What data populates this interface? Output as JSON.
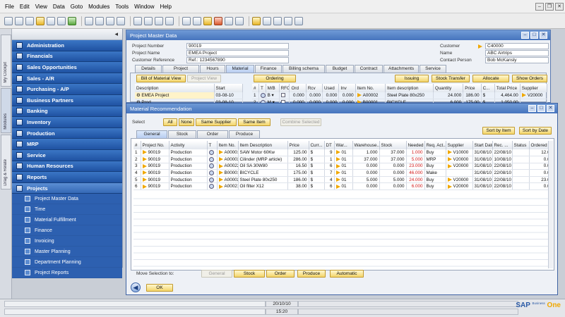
{
  "menu": [
    "File",
    "Edit",
    "View",
    "Data",
    "Goto",
    "Modules",
    "Tools",
    "Window",
    "Help"
  ],
  "vtabs": [
    "My Cockpit",
    "Modules",
    "Drag & Relate"
  ],
  "sidebar": {
    "modules": [
      "Administration",
      "Financials",
      "Sales Opportunities",
      "Sales - A/R",
      "Purchasing - A/P",
      "Business Partners",
      "Banking",
      "Inventory",
      "Production",
      "MRP",
      "Service",
      "Human Resources",
      "Reports",
      "Projects"
    ],
    "sub": [
      "Project Master Data",
      "Time",
      "Material Fulfillment",
      "Finance",
      "Invoicing",
      "Master Planning",
      "Department Planning",
      "Project Reports"
    ]
  },
  "pmd": {
    "title": "Project Master Data",
    "project_number_label": "Project Number",
    "project_number": "90019",
    "project_name_label": "Project Name",
    "project_name": "EMEA Project",
    "cust_ref_label": "Customer Reference",
    "cust_ref": "Ref.: 1234567890",
    "customer_label": "Customer",
    "customer": "C40000",
    "name_label": "Name",
    "name": "ABC Airtrips",
    "contact_label": "Contact Person",
    "contact": "Bob McKansly",
    "tabs": [
      "Details",
      "Project Members",
      "Hours",
      "Material",
      "Finance",
      "Billing schema",
      "Budget",
      "Contract",
      "Attachments",
      "Service"
    ],
    "btn_bom": "Bill of Material View",
    "btn_pv": "Project View",
    "btn_ordering": "Ordering",
    "btn_issuing": "Issuing",
    "btn_stock_transfer": "Stock Transfer",
    "btn_allocate": "Allocate",
    "btn_show_orders": "Show Orders",
    "tree_head": [
      "Description",
      "Start"
    ],
    "tree": [
      {
        "desc": "EMEA Project",
        "start": "03-08-10"
      },
      {
        "desc": "Prod",
        "start": "03-08-10"
      }
    ],
    "grid_head": [
      "#",
      "T",
      "M/B",
      "RFO",
      "Ord",
      "Rcv",
      "Used",
      "Inv",
      "Item No.",
      "Item description",
      "Quantity",
      "Price",
      "C...",
      "Total Price",
      "Supplier"
    ],
    "grid_rows": [
      {
        "n": "1",
        "t": "",
        "mb": "B",
        "ord": "0.000",
        "rcv": "0.000",
        "used": "0.000",
        "inv": "0.000",
        "item": "A00002",
        "desc": "Steel Plate 80x250",
        "qty": "24.000",
        "price": "186.00",
        "cur": "$",
        "total": "4,464.00",
        "sup": "V20000"
      },
      {
        "n": "2",
        "t": "",
        "mb": "M",
        "ord": "0.000",
        "rcv": "0.000",
        "used": "0.000",
        "inv": "0.000",
        "item": "B00001",
        "desc": "BICYCLE",
        "qty": "6.000",
        "price": "175.00",
        "cur": "$",
        "total": "1,050.00",
        "sup": ""
      }
    ]
  },
  "mr": {
    "title": "Material Recommendation",
    "select_label": "Select",
    "select_btns": [
      "All",
      "None",
      "Same Supplier",
      "Same Item",
      "Combine Selected"
    ],
    "tabs": [
      "General",
      "Stock",
      "Order",
      "Produce"
    ],
    "sort_item": "Sort by Item",
    "sort_date": "Sort by Date",
    "head": [
      "#",
      "Project No.",
      "Activity",
      "T",
      "Item No.",
      "Item Description",
      "Price",
      "Curr...",
      "DT",
      "War...",
      "Warehouse...",
      "Stock",
      "Needed",
      "Req. Act...",
      "Supplier",
      "Start Date",
      "Rec. ...",
      "Status",
      "Ordered"
    ],
    "rows": [
      {
        "n": "1",
        "proj": "90019",
        "act": "Production",
        "item": "A00001",
        "desc": "SAW Motor 60Kw",
        "price": "125.00",
        "cur": "$",
        "dt": "9",
        "war": "01",
        "wh": "1.000",
        "stock": "37.000",
        "need": "1.000",
        "req": "Buy",
        "sup": "V10000",
        "start": "31/08/10",
        "rec": "22/08/10",
        "status": "",
        "ord": "12.0"
      },
      {
        "n": "2",
        "proj": "90019",
        "act": "Production",
        "item": "A00003",
        "desc": "Cilinder (MRP article)",
        "price": "286.00",
        "cur": "$",
        "dt": "1",
        "war": "01",
        "wh": "37.000",
        "stock": "37.000",
        "need": "5.000",
        "req": "MRP",
        "sup": "V20000",
        "start": "31/08/10",
        "rec": "10/08/10",
        "status": "",
        "ord": "0.0"
      },
      {
        "n": "3",
        "proj": "90019",
        "act": "Production",
        "item": "A00022",
        "desc": "Oil SA 30W80",
        "price": "16.50",
        "cur": "$",
        "dt": "6",
        "war": "01",
        "wh": "0.000",
        "stock": "0.000",
        "need": "23.000",
        "req": "Buy",
        "sup": "V20000",
        "start": "31/08/10",
        "rec": "22/08/10",
        "status": "",
        "ord": "0.0"
      },
      {
        "n": "4",
        "proj": "90019",
        "act": "Production",
        "item": "B00001",
        "desc": "BICYCLE",
        "price": "175.00",
        "cur": "$",
        "dt": "7",
        "war": "01",
        "wh": "0.000",
        "stock": "0.000",
        "need": "46.000",
        "req": "Make",
        "sup": "",
        "start": "31/08/10",
        "rec": "22/08/10",
        "status": "",
        "ord": "0.0"
      },
      {
        "n": "5",
        "proj": "90019",
        "act": "Production",
        "item": "A00002",
        "desc": "Steel Plate 80x250",
        "price": "186.00",
        "cur": "$",
        "dt": "4",
        "war": "01",
        "wh": "5.000",
        "stock": "5.000",
        "need": "24.000",
        "req": "Buy",
        "sup": "V20000",
        "start": "31/08/10",
        "rec": "22/08/10",
        "status": "",
        "ord": "23.0"
      },
      {
        "n": "6",
        "proj": "90019",
        "act": "Production",
        "item": "A00021",
        "desc": "Oil filter X12",
        "price": "38.00",
        "cur": "$",
        "dt": "6",
        "war": "01",
        "wh": "0.000",
        "stock": "0.000",
        "need": "6.000",
        "req": "Buy",
        "sup": "V20000",
        "start": "31/08/10",
        "rec": "22/08/10",
        "status": "",
        "ord": "0.0"
      }
    ],
    "move_label": "Move Selection to:",
    "move_btns": [
      "General",
      "Stock",
      "Order",
      "Produce",
      "Automatic"
    ],
    "ok": "OK"
  },
  "status": {
    "date": "20/10/10",
    "time": "15:20"
  },
  "brand": {
    "sap": "SAP",
    "business": "Business",
    "one": "One"
  },
  "icons": {
    "arrow": "link-arrow-icon",
    "back": "back-arrow-icon"
  }
}
